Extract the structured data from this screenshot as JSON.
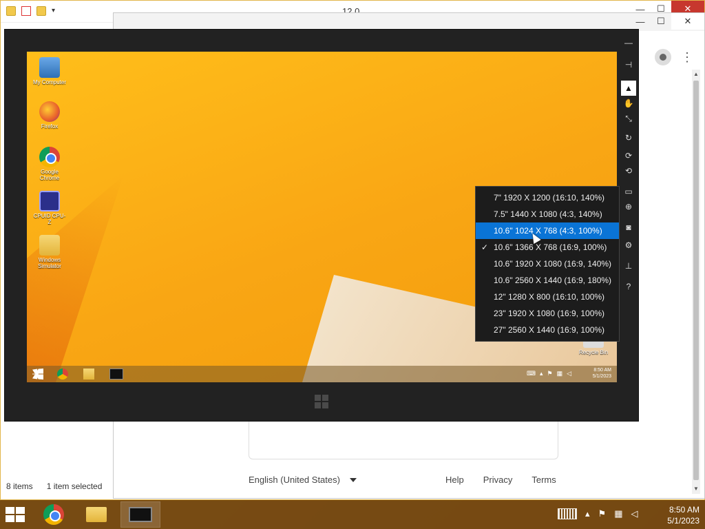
{
  "explorer": {
    "title": "12.0",
    "status_items": "8 items",
    "status_selected": "1 item selected",
    "controls": {
      "minimize": "—",
      "maximize": "☐",
      "close": "✕"
    }
  },
  "browser": {
    "controls": {
      "minimize": "—",
      "maximize": "☐",
      "close": "✕"
    },
    "footer": {
      "language": "English (United States)",
      "help": "Help",
      "privacy": "Privacy",
      "terms": "Terms"
    }
  },
  "simulator": {
    "desktop_icons": [
      {
        "label": "My Computer"
      },
      {
        "label": "Firefox"
      },
      {
        "label": "Google Chrome"
      },
      {
        "label": "CPUID CPU-Z"
      },
      {
        "label": "Windows Simulator"
      },
      {
        "label": "Recycle Bin"
      }
    ],
    "taskbar_time": "8:50 AM",
    "taskbar_date": "5/1/2023",
    "toolbar": [
      {
        "name": "minimize",
        "glyph": "—"
      },
      {
        "name": "pin",
        "glyph": "⊣"
      },
      {
        "name": "mouse-mode",
        "glyph": "▲"
      },
      {
        "name": "touch-mode",
        "glyph": "✋"
      },
      {
        "name": "pinch-zoom",
        "glyph": "⤡"
      },
      {
        "name": "rotation-touch",
        "glyph": "↻"
      },
      {
        "name": "rotate-clockwise",
        "glyph": "⟳"
      },
      {
        "name": "rotate-counterclockwise",
        "glyph": "⟲"
      },
      {
        "name": "change-resolution",
        "glyph": "▭"
      },
      {
        "name": "set-location",
        "glyph": "⊕"
      },
      {
        "name": "screenshot",
        "glyph": "◙"
      },
      {
        "name": "settings",
        "glyph": "⚙"
      },
      {
        "name": "network",
        "glyph": "⊥"
      },
      {
        "name": "help",
        "glyph": "?"
      }
    ],
    "resolution_menu": [
      {
        "label": "7\" 1920 X 1200 (16:10, 140%)",
        "checked": false,
        "hover": false
      },
      {
        "label": "7.5\" 1440 X 1080 (4:3, 140%)",
        "checked": false,
        "hover": false
      },
      {
        "label": "10.6\" 1024 X 768 (4:3, 100%)",
        "checked": false,
        "hover": true
      },
      {
        "label": "10.6\" 1366 X 768 (16:9, 100%)",
        "checked": true,
        "hover": false
      },
      {
        "label": "10.6\" 1920 X 1080 (16:9, 140%)",
        "checked": false,
        "hover": false
      },
      {
        "label": "10.6\" 2560 X 1440 (16:9, 180%)",
        "checked": false,
        "hover": false
      },
      {
        "label": "12\" 1280 X 800 (16:10, 100%)",
        "checked": false,
        "hover": false
      },
      {
        "label": "23\" 1920 X 1080 (16:9, 100%)",
        "checked": false,
        "hover": false
      },
      {
        "label": "27\" 2560 X 1440 (16:9, 100%)",
        "checked": false,
        "hover": false
      }
    ],
    "check_glyph": "✓"
  },
  "host_taskbar": {
    "time": "8:50 AM",
    "date": "5/1/2023"
  }
}
